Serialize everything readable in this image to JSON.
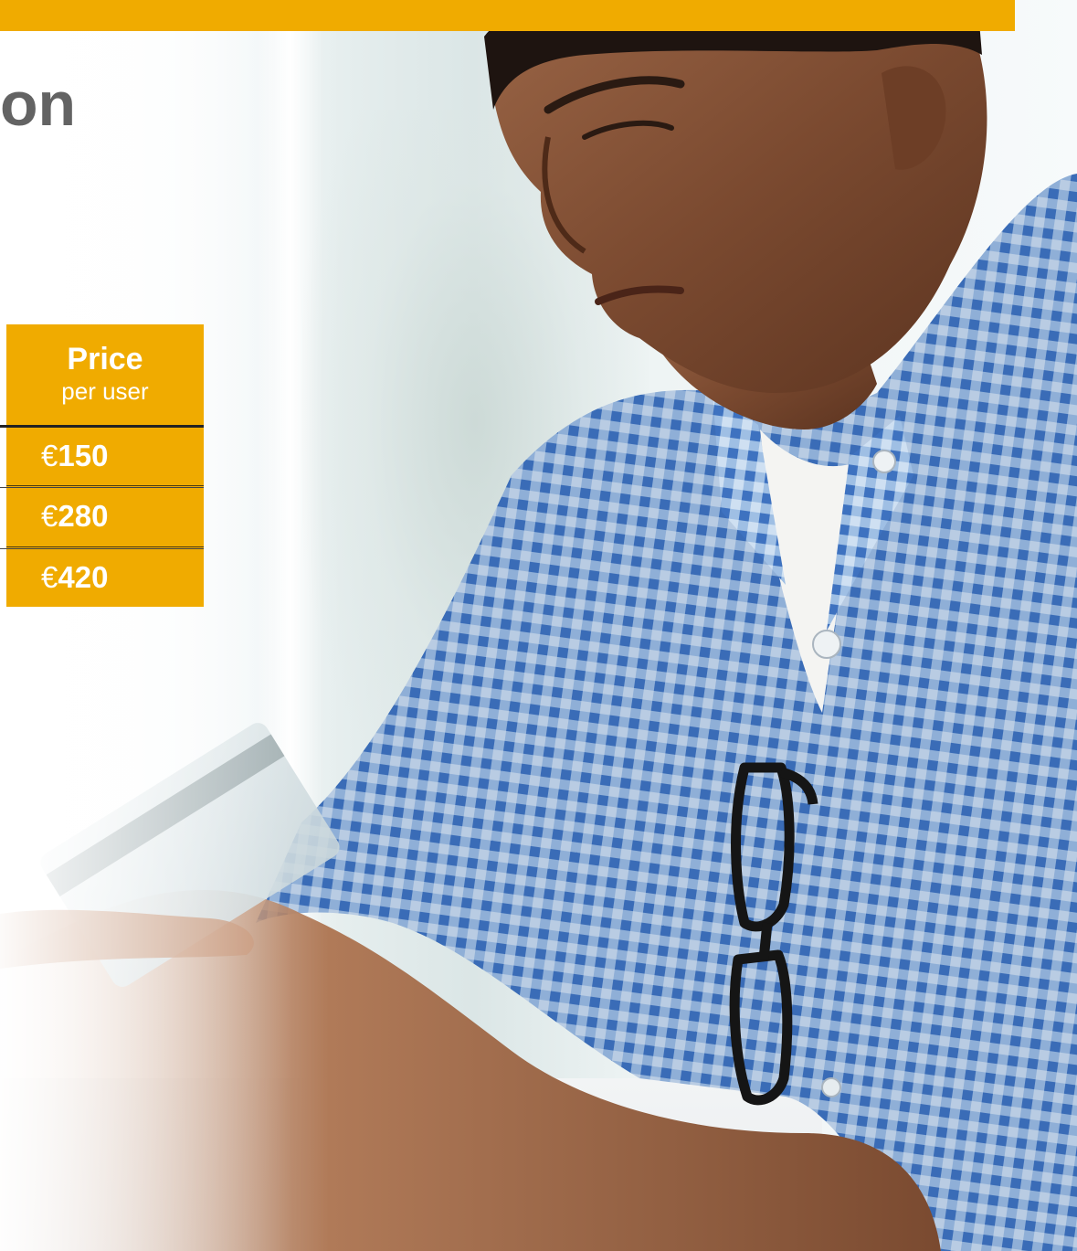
{
  "header": {
    "accent_color": "#f0ab00",
    "title_fragment": "on"
  },
  "price_table": {
    "heading": "Price",
    "subheading": "per user",
    "rows": [
      {
        "currency": "€",
        "amount": "150"
      },
      {
        "currency": "€",
        "amount": "280"
      },
      {
        "currency": "€",
        "amount": "420"
      }
    ]
  },
  "photo": {
    "subject": "photo-man-with-credit-card-icon"
  }
}
